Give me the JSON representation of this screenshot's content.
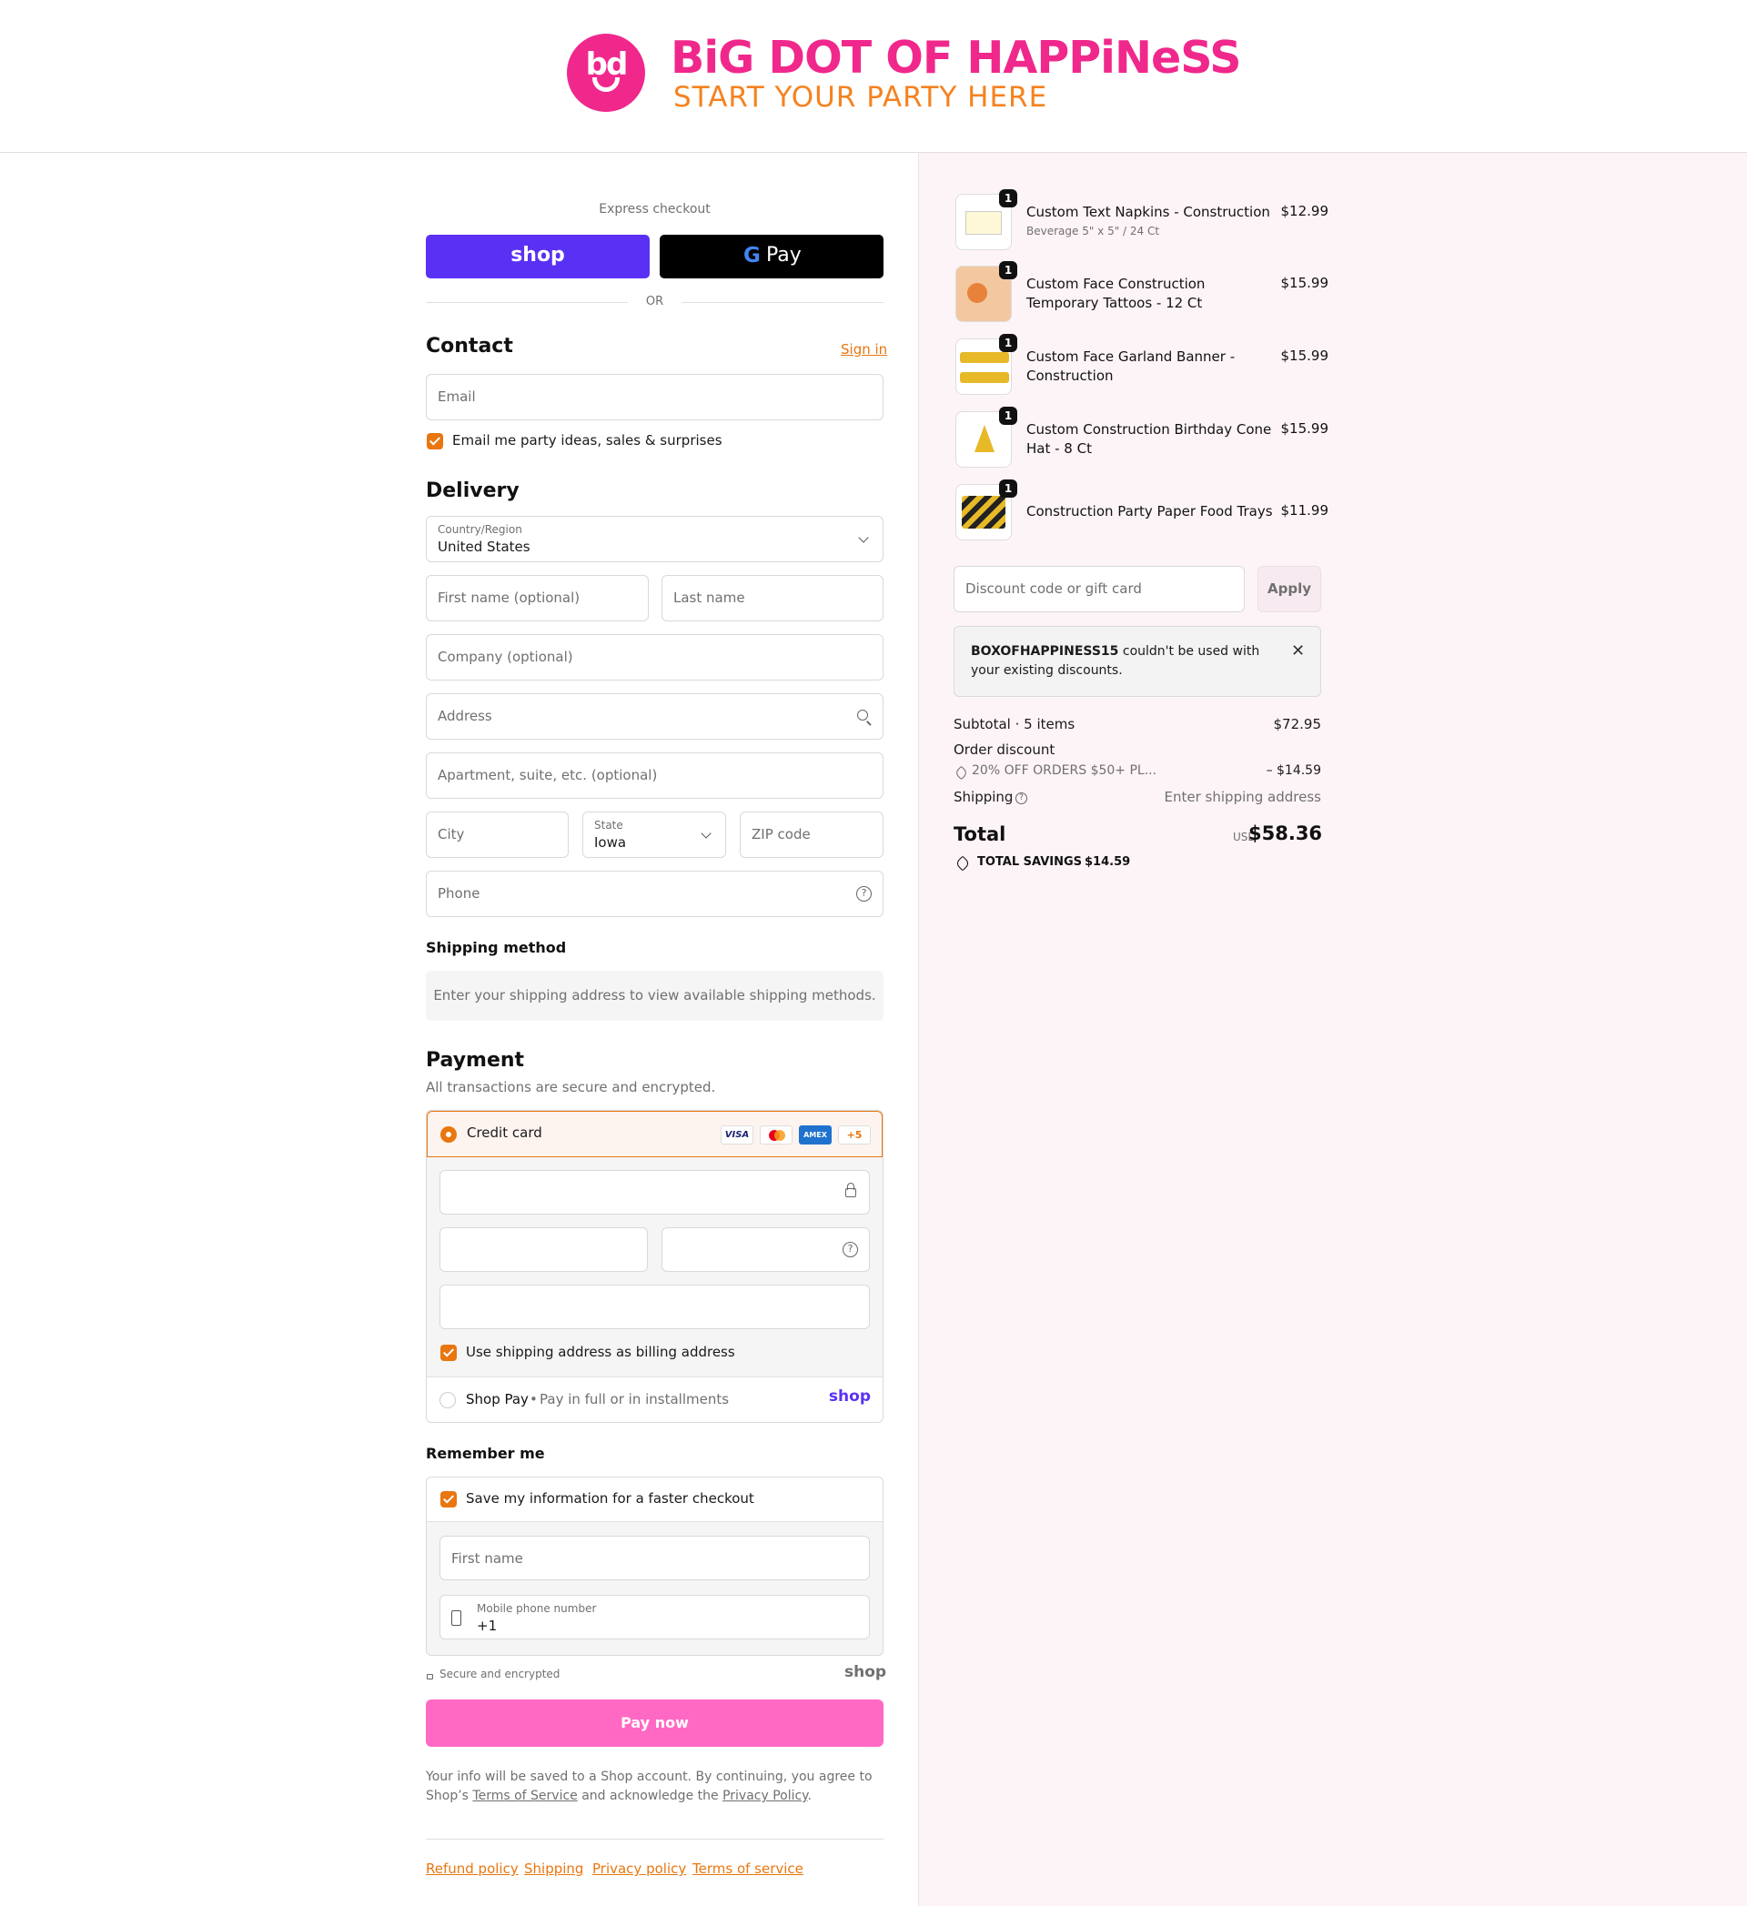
{
  "brand": {
    "logo_mark": "bd",
    "name": "BiG DOT OF HAPPiNeSS",
    "tagline": "START YOUR PARTY HERE",
    "pink": "#f0288c",
    "orange": "#f58220"
  },
  "express": {
    "label": "Express checkout",
    "shop_pay": "shop",
    "gpay": "Pay",
    "or": "OR"
  },
  "contact": {
    "title": "Contact",
    "sign_in": "Sign in",
    "email_placeholder": "Email",
    "marketing_checked": true,
    "marketing_label": "Email me party ideas, sales & surprises"
  },
  "delivery": {
    "title": "Delivery",
    "country_label": "Country/Region",
    "country_value": "United States",
    "first_name": "First name (optional)",
    "last_name": "Last name",
    "company": "Company (optional)",
    "address": "Address",
    "apartment": "Apartment, suite, etc. (optional)",
    "city": "City",
    "state_label": "State",
    "state_value": "Iowa",
    "zip": "ZIP code",
    "phone": "Phone"
  },
  "shipping_method": {
    "title": "Shipping method",
    "notice": "Enter your shipping address to view available shipping methods."
  },
  "payment": {
    "title": "Payment",
    "subtitle": "All transactions are secure and encrypted.",
    "credit_card_label": "Credit card",
    "cards": [
      "VISA",
      "Mastercard",
      "AMEX"
    ],
    "more_cards": "+5",
    "billing_same_checked": true,
    "billing_same_label": "Use shipping address as billing address",
    "shop_pay_label": "Shop Pay",
    "shop_pay_desc": "Pay in full or in installments",
    "shop_pay_logo": "shop"
  },
  "remember": {
    "title": "Remember me",
    "save_checked": true,
    "save_label": "Save my information for a faster checkout",
    "first_name": "First name",
    "mobile_label": "Mobile phone number",
    "mobile_value": "+1",
    "secure_label": "Secure and encrypted",
    "shop_logo": "shop"
  },
  "pay_button": "Pay now",
  "legal": {
    "line1": "Your info will be saved to a Shop account. By continuing, you agree to",
    "prefix": "Shop’s ",
    "tos": "Terms of Service",
    "mid": " and acknowledge the ",
    "privacy": "Privacy Policy",
    "suffix": "."
  },
  "footer_links": [
    "Refund policy",
    "Shipping",
    "Privacy policy",
    "Terms of service"
  ],
  "cart": {
    "items": [
      {
        "name": "Custom Text Napkins - Construction",
        "variant": "Beverage 5\" x 5\" / 24 Ct",
        "price": "$12.99",
        "qty": "1"
      },
      {
        "name": "Custom Face Construction Temporary Tattoos - 12 Ct",
        "variant": "",
        "price": "$15.99",
        "qty": "1"
      },
      {
        "name": "Custom Face Garland Banner - Construction",
        "variant": "",
        "price": "$15.99",
        "qty": "1"
      },
      {
        "name": "Custom Construction Birthday Cone Hat - 8 Ct",
        "variant": "",
        "price": "$15.99",
        "qty": "1"
      },
      {
        "name": "Construction Party Paper Food Trays",
        "variant": "",
        "price": "$11.99",
        "qty": "1"
      }
    ],
    "discount_placeholder": "Discount code or gift card",
    "apply": "Apply",
    "error_code": "BOXOFHAPPINESS15",
    "error_text1": " couldn't be used with",
    "error_text2": "your existing discounts.",
    "subtotal_label": "Subtotal · 5 items",
    "subtotal_value": "$72.95",
    "order_discount_label": "Order discount",
    "discount_name": "20% OFF ORDERS $50+ PL...",
    "discount_value": "– $14.59",
    "shipping_label": "Shipping",
    "shipping_value": "Enter shipping address",
    "total_label": "Total",
    "currency": "USD",
    "total_value": "$58.36",
    "savings_label": "TOTAL SAVINGS",
    "savings_value": "$14.59"
  }
}
